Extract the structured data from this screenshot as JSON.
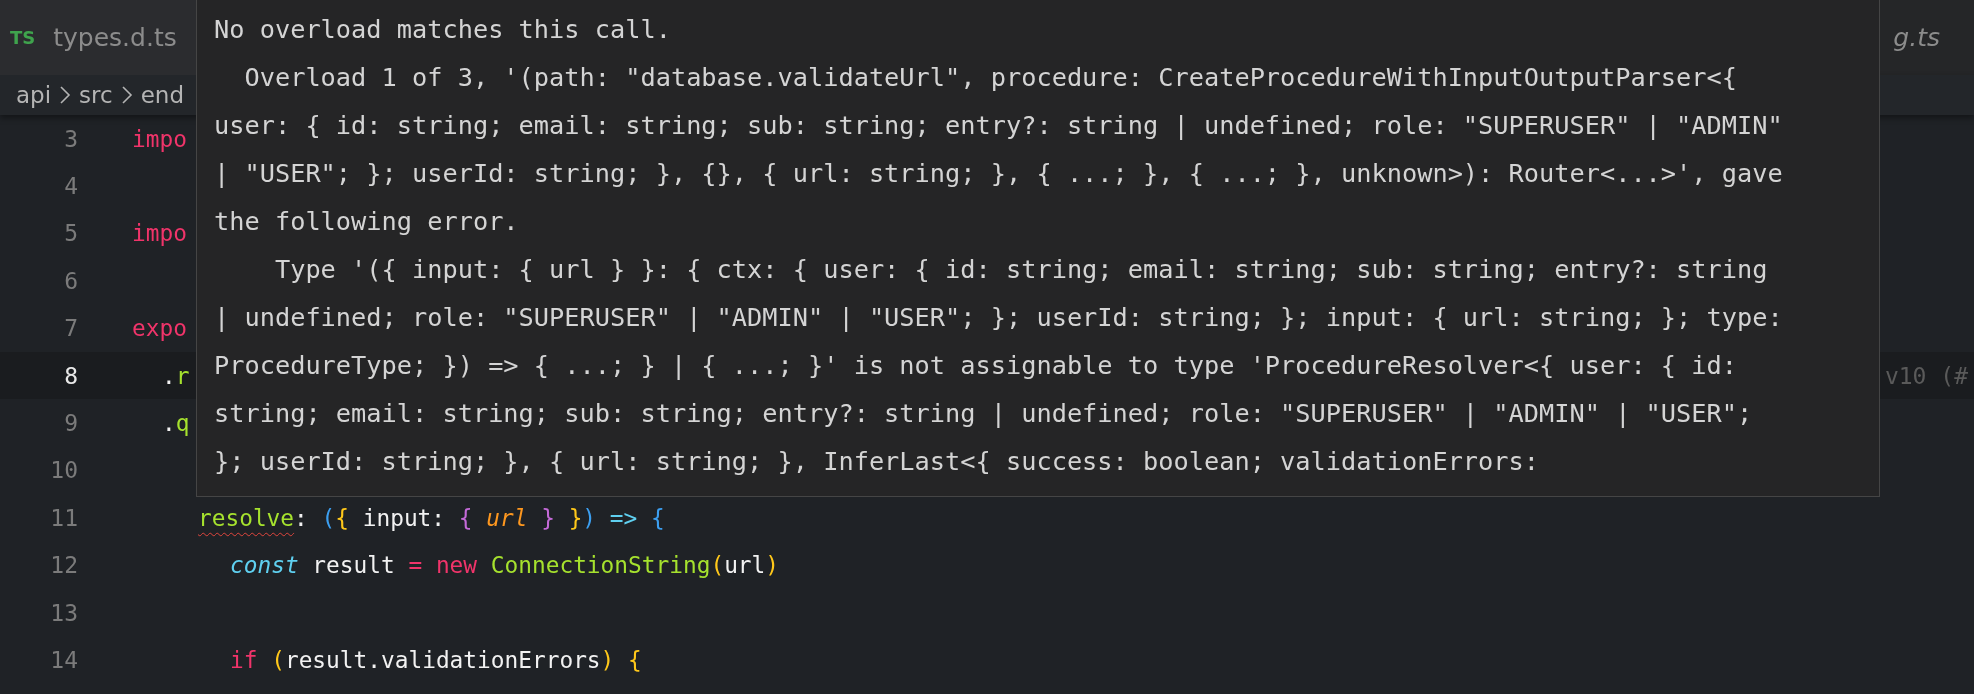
{
  "tabs": [
    {
      "badge": "TS",
      "label": "types.d.ts",
      "italic": false
    },
    {
      "label": "g.ts",
      "italic": true
    }
  ],
  "breadcrumb": [
    "api",
    "src",
    "end"
  ],
  "lines": [
    {
      "number": "3",
      "current": false,
      "kind": "top",
      "tokens": [
        {
          "text": "impo",
          "kind": "keyword"
        }
      ]
    },
    {
      "number": "4",
      "current": false
    },
    {
      "number": "5",
      "current": false,
      "kind": "top",
      "tokens": [
        {
          "text": "impo",
          "kind": "keyword"
        }
      ]
    },
    {
      "number": "6",
      "current": false
    },
    {
      "number": "7",
      "current": false,
      "kind": "top",
      "tokens": [
        {
          "text": "expo",
          "kind": "keyword"
        }
      ]
    },
    {
      "number": "8",
      "current": true,
      "kind": "chain",
      "tokens": [
        {
          "text": ".",
          "kind": "plain"
        },
        {
          "text": "r",
          "kind": "function"
        }
      ],
      "blame": "v10 (#"
    },
    {
      "number": "9",
      "current": false,
      "kind": "chain",
      "tokens": [
        {
          "text": ".",
          "kind": "plain"
        },
        {
          "text": "q",
          "kind": "function"
        }
      ]
    },
    {
      "number": "10",
      "current": false
    },
    {
      "number": "11",
      "current": false,
      "kind": "property",
      "tokens": [
        {
          "text": "resolve",
          "kind": "function",
          "error": true
        },
        {
          "text": ": ",
          "kind": "plain"
        },
        {
          "text": "(",
          "kind": "paren"
        },
        {
          "text": "{",
          "kind": "brace"
        },
        {
          "text": " input: ",
          "kind": "plain"
        },
        {
          "text": "{",
          "kind": "brace2"
        },
        {
          "text": " url ",
          "kind": "param"
        },
        {
          "text": "}",
          "kind": "brace2"
        },
        {
          "text": " }",
          "kind": "brace"
        },
        {
          "text": ")",
          "kind": "paren"
        },
        {
          "text": " => ",
          "kind": "arrow"
        },
        {
          "text": "{",
          "kind": "paren"
        }
      ]
    },
    {
      "number": "12",
      "current": false,
      "kind": "statement",
      "tokens": [
        {
          "text": "const",
          "kind": "storage"
        },
        {
          "text": " result ",
          "kind": "plain"
        },
        {
          "text": "= new",
          "kind": "keyword"
        },
        {
          "text": " ConnectionString",
          "kind": "function"
        },
        {
          "text": "(",
          "kind": "brace"
        },
        {
          "text": "url",
          "kind": "plain"
        },
        {
          "text": ")",
          "kind": "brace"
        }
      ]
    },
    {
      "number": "13",
      "current": false
    },
    {
      "number": "14",
      "current": false,
      "kind": "statement",
      "tokens": [
        {
          "text": "if ",
          "kind": "keyword"
        },
        {
          "text": "(",
          "kind": "brace"
        },
        {
          "text": "result.validationErrors",
          "kind": "plain"
        },
        {
          "text": ") {",
          "kind": "brace"
        }
      ]
    }
  ],
  "tooltip": {
    "lines": [
      "No overload matches this call.",
      "  Overload 1 of 3, '(path: \"database.validateUrl\", procedure: CreateProcedureWithInputOutputParser<{",
      "user: { id: string; email: string; sub: string; entry?: string | undefined; role: \"SUPERUSER\" | \"ADMIN\"",
      "| \"USER\"; }; userId: string; }, {}, { url: string; }, { ...; }, { ...; }, unknown>): Router<...>', gave",
      "the following error.",
      "    Type '({ input: { url } }: { ctx: { user: { id: string; email: string; sub: string; entry?: string",
      "| undefined; role: \"SUPERUSER\" | \"ADMIN\" | \"USER\"; }; userId: string; }; input: { url: string; }; type:",
      "ProcedureType; }) => { ...; } | { ...; }' is not assignable to type 'ProcedureResolver<{ user: { id:",
      "string; email: string; sub: string; entry?: string | undefined; role: \"SUPERUSER\" | \"ADMIN\" | \"USER\";",
      "}; userId: string; }, { url: string; }, InferLast<{ success: boolean; validationErrors:"
    ]
  }
}
